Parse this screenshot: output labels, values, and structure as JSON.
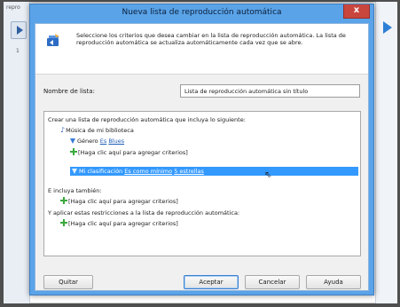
{
  "background": {
    "left_label": "repro",
    "left_number": "1"
  },
  "dialog": {
    "title": "Nueva lista de reproducción automática",
    "close_glyph": "x",
    "description": "Seleccione los criterios que desea cambiar en la lista de reproducción automática. La lista de reproducción automática se actualiza automáticamente cada vez que se abre.",
    "name_label": "Nombre de lista:",
    "name_value": "Lista de reproducción automática sin título",
    "criteria": {
      "intro": "Crear una lista de reproducción automática que incluya lo siguiente:",
      "library": "Música de mi biblioteca",
      "genre": {
        "field": "Género",
        "operator": "Es",
        "value": "Blues"
      },
      "rating": {
        "field": "Mi clasificación",
        "operator": "Es como mínimo",
        "value": "5 estrellas"
      },
      "add_criteria_1": "[Haga clic aquí para agregar criterios]",
      "also_include": "E incluya también:",
      "add_criteria_2": "[Haga clic aquí para agregar criterios]",
      "restrictions": "Y aplicar estas restricciones a la lista de reproducción automática:",
      "add_criteria_3": "[Haga clic aquí para agregar criterios]"
    },
    "buttons": {
      "remove": "Quitar",
      "ok": "Aceptar",
      "cancel": "Cancelar",
      "help": "Ayuda"
    }
  },
  "colors": {
    "title_bar": "#5aa3e8",
    "selection": "#3399ff",
    "link": "#1d5db5",
    "close_button": "#c9463d"
  }
}
